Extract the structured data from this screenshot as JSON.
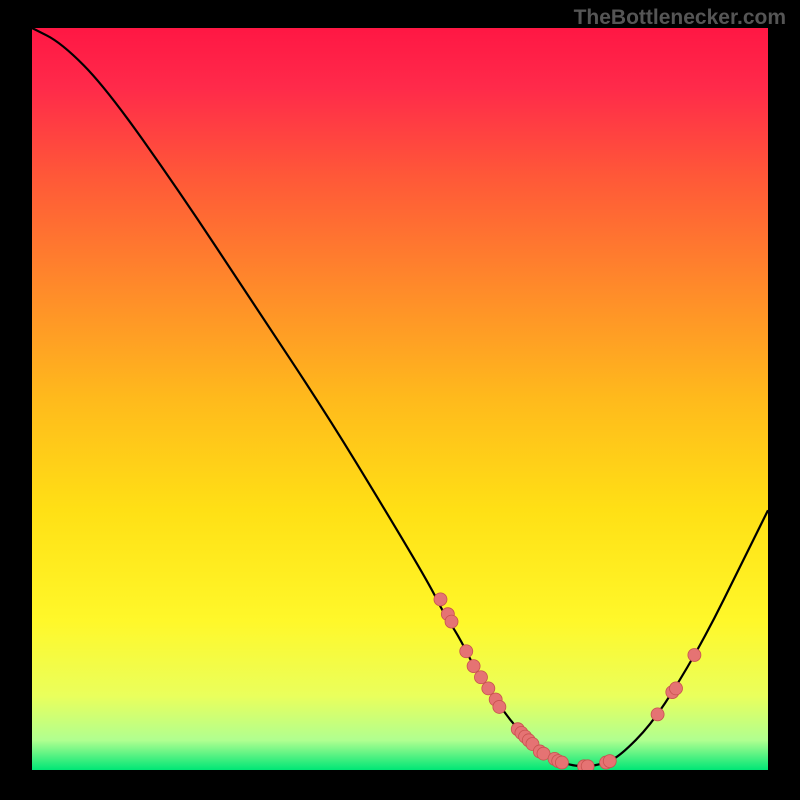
{
  "watermark": "TheBottlenecker.com",
  "chart_data": {
    "type": "line",
    "title": "",
    "xlabel": "",
    "ylabel": "",
    "x_range": [
      0,
      100
    ],
    "y_range": [
      0,
      100
    ],
    "curve": [
      {
        "x": 0,
        "y": 100
      },
      {
        "x": 4,
        "y": 98
      },
      {
        "x": 10,
        "y": 92
      },
      {
        "x": 20,
        "y": 78
      },
      {
        "x": 30,
        "y": 63
      },
      {
        "x": 40,
        "y": 48
      },
      {
        "x": 48,
        "y": 35
      },
      {
        "x": 54,
        "y": 25
      },
      {
        "x": 56,
        "y": 21
      },
      {
        "x": 58,
        "y": 18
      },
      {
        "x": 60,
        "y": 14
      },
      {
        "x": 62,
        "y": 11
      },
      {
        "x": 64,
        "y": 8
      },
      {
        "x": 66,
        "y": 5.5
      },
      {
        "x": 68,
        "y": 3.5
      },
      {
        "x": 70,
        "y": 2
      },
      {
        "x": 72,
        "y": 1
      },
      {
        "x": 74,
        "y": 0.5
      },
      {
        "x": 76,
        "y": 0.5
      },
      {
        "x": 78,
        "y": 1
      },
      {
        "x": 80,
        "y": 2
      },
      {
        "x": 84,
        "y": 6
      },
      {
        "x": 88,
        "y": 12
      },
      {
        "x": 92,
        "y": 19
      },
      {
        "x": 96,
        "y": 27
      },
      {
        "x": 100,
        "y": 35
      }
    ],
    "markers": [
      {
        "x": 55.5,
        "y": 23
      },
      {
        "x": 56.5,
        "y": 21
      },
      {
        "x": 57,
        "y": 20
      },
      {
        "x": 59,
        "y": 16
      },
      {
        "x": 60,
        "y": 14
      },
      {
        "x": 61,
        "y": 12.5
      },
      {
        "x": 62,
        "y": 11
      },
      {
        "x": 63,
        "y": 9.5
      },
      {
        "x": 63.5,
        "y": 8.5
      },
      {
        "x": 66,
        "y": 5.5
      },
      {
        "x": 66.5,
        "y": 5
      },
      {
        "x": 67,
        "y": 4.5
      },
      {
        "x": 67.5,
        "y": 4
      },
      {
        "x": 68,
        "y": 3.5
      },
      {
        "x": 69,
        "y": 2.5
      },
      {
        "x": 69.5,
        "y": 2.2
      },
      {
        "x": 71,
        "y": 1.5
      },
      {
        "x": 71.5,
        "y": 1.2
      },
      {
        "x": 72,
        "y": 1
      },
      {
        "x": 75,
        "y": 0.5
      },
      {
        "x": 75.5,
        "y": 0.5
      },
      {
        "x": 78,
        "y": 1
      },
      {
        "x": 78.5,
        "y": 1.2
      },
      {
        "x": 85,
        "y": 7.5
      },
      {
        "x": 87,
        "y": 10.5
      },
      {
        "x": 87.5,
        "y": 11
      },
      {
        "x": 90,
        "y": 15.5
      }
    ],
    "gradient_stops": [
      {
        "offset": 0,
        "color": "#ff1744"
      },
      {
        "offset": 0.08,
        "color": "#ff2a4a"
      },
      {
        "offset": 0.2,
        "color": "#ff5838"
      },
      {
        "offset": 0.35,
        "color": "#ff8a2a"
      },
      {
        "offset": 0.5,
        "color": "#ffba1c"
      },
      {
        "offset": 0.65,
        "color": "#ffe015"
      },
      {
        "offset": 0.8,
        "color": "#fff82a"
      },
      {
        "offset": 0.9,
        "color": "#eaff5c"
      },
      {
        "offset": 0.96,
        "color": "#b0ff90"
      },
      {
        "offset": 1.0,
        "color": "#00e676"
      }
    ],
    "marker_color": "#e57373",
    "marker_stroke": "#c8524f",
    "line_color": "#000000"
  }
}
